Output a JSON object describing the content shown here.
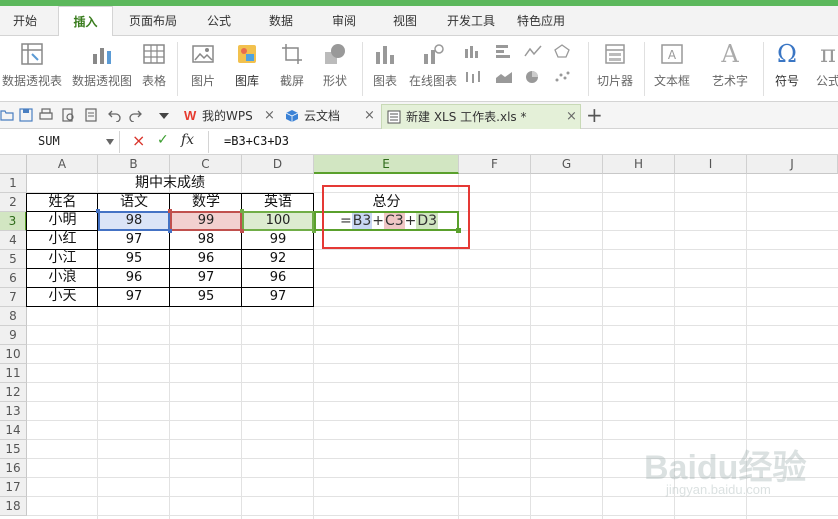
{
  "menu": {
    "tabs": [
      "开始",
      "插入",
      "页面布局",
      "公式",
      "数据",
      "审阅",
      "视图",
      "开发工具",
      "特色应用"
    ],
    "active_index": 1
  },
  "ribbon": {
    "items": [
      {
        "label": "数据透视表",
        "icon": "pivot-table-icon"
      },
      {
        "label": "数据透视图",
        "icon": "pivot-chart-icon"
      },
      {
        "label": "表格",
        "icon": "table-icon"
      },
      {
        "label": "图片",
        "icon": "picture-icon"
      },
      {
        "label": "图库",
        "icon": "gallery-icon"
      },
      {
        "label": "截屏",
        "icon": "screenshot-icon"
      },
      {
        "label": "形状",
        "icon": "shapes-icon"
      },
      {
        "label": "图表",
        "icon": "chart-icon"
      },
      {
        "label": "在线图表",
        "icon": "online-chart-icon"
      },
      {
        "label": "切片器",
        "icon": "slicer-icon"
      },
      {
        "label": "文本框",
        "icon": "textbox-icon"
      },
      {
        "label": "艺术字",
        "icon": "wordart-icon"
      },
      {
        "label": "符号",
        "icon": "symbol-icon"
      },
      {
        "label": "公式",
        "icon": "equation-icon"
      }
    ],
    "symbol_glyph": "Ω",
    "equation_glyph": "π",
    "wordart_glyph": "A"
  },
  "doctabs": [
    {
      "label": "我的WPS",
      "close": "×"
    },
    {
      "label": "云文档",
      "close": "×"
    },
    {
      "label": "新建 XLS 工作表.xls *",
      "close": "×"
    }
  ],
  "add_tab": "+",
  "formula_bar": {
    "name_box": "SUM",
    "cancel": "×",
    "confirm": "✓",
    "fx": "fx",
    "formula": "=B3+C3+D3"
  },
  "columns": [
    "A",
    "B",
    "C",
    "D",
    "E",
    "F",
    "G",
    "H",
    "I",
    "J"
  ],
  "rows": [
    "1",
    "2",
    "3",
    "4",
    "5",
    "6",
    "7",
    "8",
    "9",
    "10",
    "11",
    "12",
    "13",
    "14",
    "15",
    "16",
    "17",
    "18"
  ],
  "sheet": {
    "title": "期中末成绩",
    "headers": [
      "姓名",
      "语文",
      "数学",
      "英语"
    ],
    "total_header": "总分",
    "table": [
      [
        "小明",
        "98",
        "99",
        "100"
      ],
      [
        "小红",
        "97",
        "98",
        "99"
      ],
      [
        "小江",
        "95",
        "96",
        "92"
      ],
      [
        "小浪",
        "96",
        "97",
        "96"
      ],
      [
        "小天",
        "97",
        "95",
        "97"
      ]
    ],
    "edit_formula": {
      "eq": "=",
      "ref1": "B3",
      "plus1": "+",
      "ref2": "C3",
      "plus2": "+",
      "ref3": "D3"
    }
  },
  "watermark": {
    "brand": "Baidu经验",
    "url": "jingyan.baidu.com"
  },
  "colors": {
    "accent": "#5cb85c",
    "ref_b": "#4472c4",
    "ref_c": "#c0504d",
    "ref_d": "#70ad47",
    "highlight_box": "#e53935"
  }
}
